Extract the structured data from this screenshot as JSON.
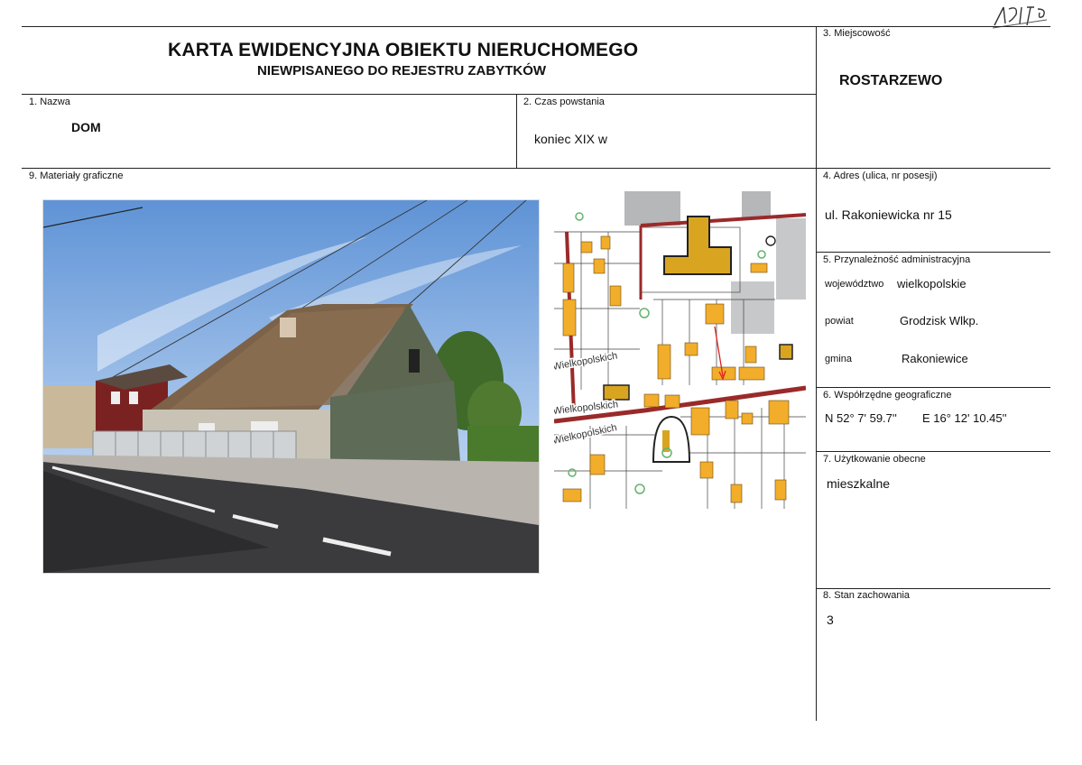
{
  "header": {
    "title": "KARTA EWIDENCYJNA OBIEKTU NIERUCHOMEGO",
    "subtitle": "NIEWPISANEGO DO REJESTRU ZABYTKÓW"
  },
  "fields": {
    "name": {
      "label": "1. Nazwa",
      "value": "DOM"
    },
    "period": {
      "label": "2. Czas powstania",
      "value": "koniec  XIX w"
    },
    "locality": {
      "label": "3. Miejscowość",
      "value": "ROSTARZEWO"
    },
    "address": {
      "label": "4. Adres (ulica, nr posesji)",
      "value": "ul. Rakoniewicka  nr 15"
    },
    "admin": {
      "label": "5. Przynależność administracyjna",
      "voivodeship_label": "województwo",
      "voivodeship_value": "wielkopolskie",
      "county_label": "powiat",
      "county_value": "Grodzisk Wlkp.",
      "commune_label": "gmina",
      "commune_value": "Rakoniewice"
    },
    "coords": {
      "label": "6. Współrzędne geograficzne",
      "north": "N  52° 7' 59.7''",
      "east": "E 16° 12' 10.45''"
    },
    "usage": {
      "label": "7. Użytkowanie obecne",
      "value": "mieszkalne"
    },
    "condition": {
      "label": "8. Stan zachowania",
      "value": "3"
    },
    "graphics": {
      "label": "9. Materiały graficzne"
    }
  },
  "map_labels": {
    "street1": "Wielkopolskich",
    "street2": "Wielkopolskich",
    "street3": "Wielkopolskich"
  },
  "colors": {
    "building_fill": "#d9a520",
    "road": "#9a2a2a",
    "sky": "#7ba9de"
  }
}
